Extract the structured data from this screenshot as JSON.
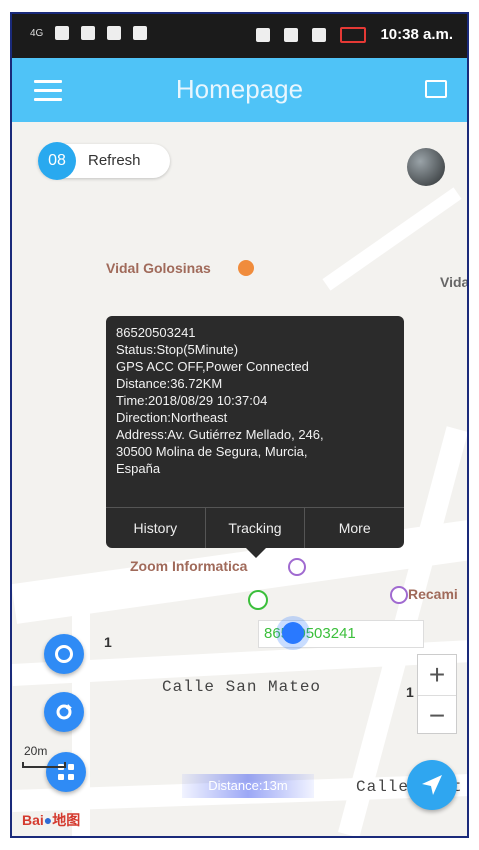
{
  "status_bar": {
    "network": "4G",
    "time": "10:38 a.m."
  },
  "appbar": {
    "title": "Homepage"
  },
  "refresh": {
    "count": "08",
    "label": "Refresh"
  },
  "map": {
    "pois": [
      "Vidal Golosinas",
      "Vida",
      "Zoom Informatica",
      "Recami"
    ],
    "streets": [
      "Calle San Mateo",
      "Calle"
    ],
    "street_suffix": "t",
    "house_numbers": [
      "1",
      "1"
    ],
    "scale_label": "20m",
    "distance_label": "Distance:13m",
    "logo_text": "Bai",
    "logo_text2": "地图"
  },
  "popup": {
    "lines": [
      "86520503241",
      "Status:Stop(5Minute)",
      "GPS ACC OFF,Power Connected",
      "Distance:36.72KM",
      "Time:2018/08/29 10:37:04",
      "Direction:Northeast",
      "Address:Av. Gutiérrez Mellado, 246,",
      "30500 Molina de Segura, Murcia,",
      "España"
    ],
    "buttons": {
      "history": "History",
      "tracking": "Tracking",
      "more": "More"
    }
  },
  "device": {
    "label": "86520503241"
  },
  "zoom": {
    "plus": "+",
    "minus": "−"
  },
  "colors": {
    "appbar": "#4fc3f7",
    "accent_blue": "#2f8bf5",
    "device_green": "#3bbf3b",
    "popup_bg": "#2b2b2b"
  },
  "icons": [
    "menu-icon",
    "chat-icon",
    "locate-icon",
    "refresh-icon",
    "grid-icon",
    "navigate-icon"
  ]
}
